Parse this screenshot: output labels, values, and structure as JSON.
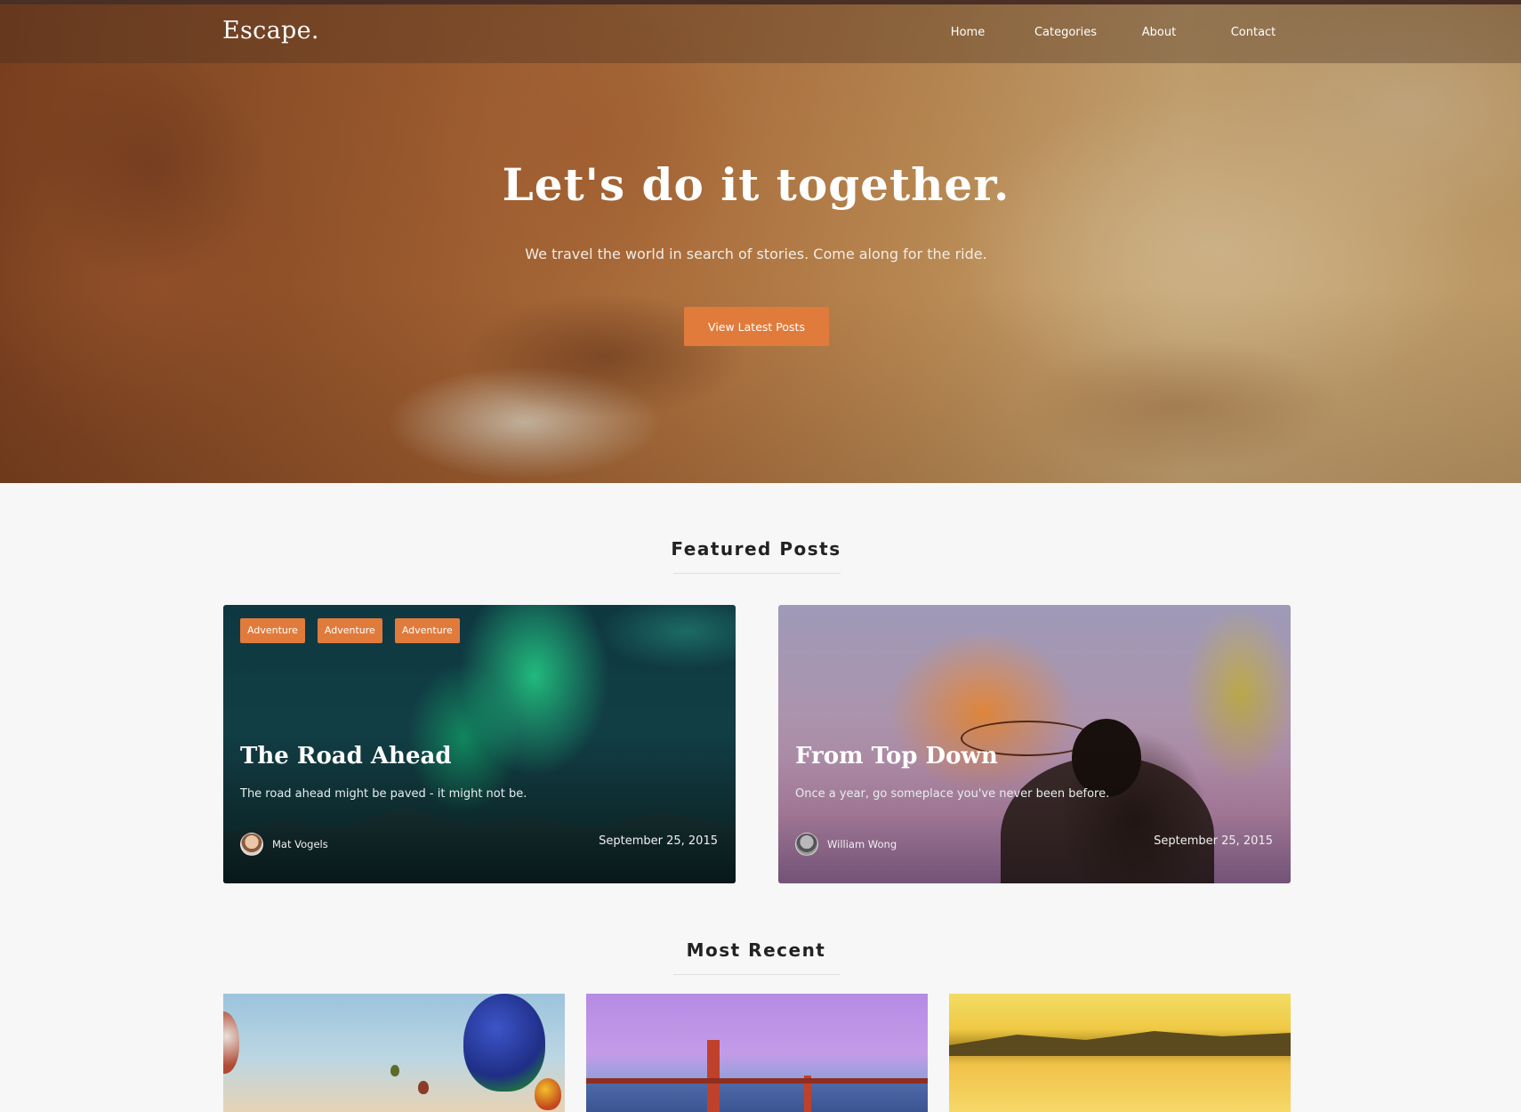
{
  "header": {
    "brand": "Escape.",
    "nav": {
      "home": "Home",
      "categories": "Categories",
      "about": "About",
      "contact": "Contact"
    }
  },
  "hero": {
    "title": "Let's do it together.",
    "subtitle": "We travel the world in search of stories. Come along for the ride.",
    "cta_label": "View Latest Posts"
  },
  "featured": {
    "heading": "Featured Posts",
    "cards": [
      {
        "tags": [
          "Adventure",
          "Adventure",
          "Adventure"
        ],
        "title": "The Road Ahead",
        "excerpt": "The road ahead might be paved - it might not be.",
        "author": "Mat Vogels",
        "date": "September 25, 2015"
      },
      {
        "title": "From Top Down",
        "excerpt": "Once a year, go someplace you've never been before.",
        "author": "William Wong",
        "date": "September 25, 2015"
      }
    ]
  },
  "recent": {
    "heading": "Most Recent"
  },
  "colors": {
    "accent": "#e07b3c",
    "page_background": "#f7f7f7"
  },
  "icons": {
    "author_avatar": "avatar"
  }
}
